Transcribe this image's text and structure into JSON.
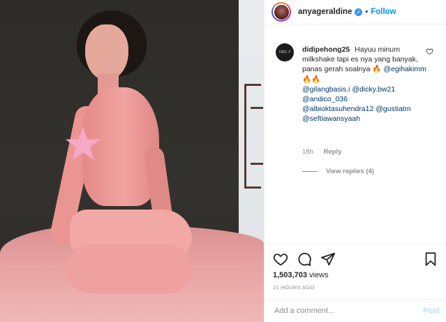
{
  "post": {
    "username": "anyageraldine",
    "follow_label": "Follow",
    "separator": "•",
    "verified_glyph": "✓"
  },
  "comment": {
    "avatar_text": "DIDI.P",
    "username": "didipehong25",
    "text_intro": "Hayuu minum milkshake tapi es nya yang banyak, panas gerah soalnya",
    "emoji_fire_1": "🔥",
    "mention_1": "@egihakimm",
    "emoji_fire_2": "🔥🔥",
    "mention_2": "@gilangbasis.i",
    "mention_3": "@dicky.bw21",
    "mention_4": "@andico_036",
    "mention_5": "@albioktasuhendra12",
    "mention_6": "@gustiatm",
    "mention_7": "@seftiawansyaah",
    "time": "18h",
    "reply_label": "Reply",
    "view_replies": "View replies (4)"
  },
  "stats": {
    "views_count": "1,503,703",
    "views_label": "views",
    "posted_ago": "21 HOURS AGO"
  },
  "comment_box": {
    "placeholder": "Add a comment...",
    "post_label": "Post"
  },
  "icons": {
    "verified": "verified-badge-icon",
    "like": "heart-icon",
    "comment": "comment-bubble-icon",
    "share": "paper-plane-icon",
    "save": "bookmark-icon",
    "comment_like": "heart-icon"
  },
  "colors": {
    "link_blue": "#0095f6",
    "post_disabled": "#b2dffc",
    "muted": "#8e8e8e",
    "text": "#262626",
    "star_pink": "#f7a8c4"
  }
}
